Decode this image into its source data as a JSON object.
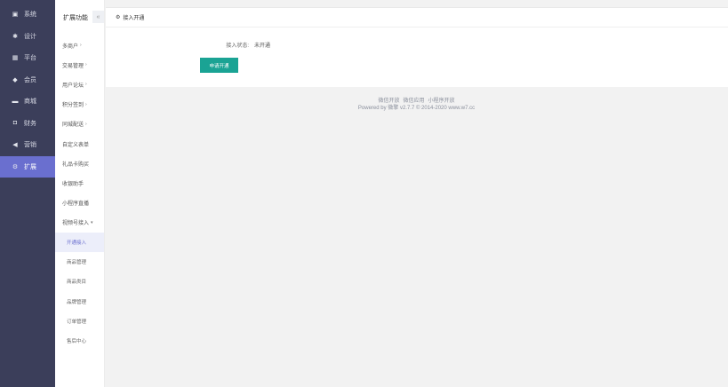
{
  "nav": {
    "items": [
      {
        "icon": "monitor-icon",
        "glyph": "▣",
        "label": "系统",
        "active": false
      },
      {
        "icon": "shirt-icon",
        "glyph": "✱",
        "label": "设计",
        "active": false
      },
      {
        "icon": "grid-icon",
        "glyph": "▦",
        "label": "平台",
        "active": false
      },
      {
        "icon": "member-icon",
        "glyph": "◆",
        "label": "会员",
        "active": false
      },
      {
        "icon": "shop-icon",
        "glyph": "▬",
        "label": "商城",
        "active": false
      },
      {
        "icon": "finance-icon",
        "glyph": "◘",
        "label": "财务",
        "active": false
      },
      {
        "icon": "megaphone-icon",
        "glyph": "◀",
        "label": "营销",
        "active": false
      },
      {
        "icon": "extend-icon",
        "glyph": "⚙",
        "label": "扩展",
        "active": true
      }
    ]
  },
  "subnav": {
    "title": "扩展功能",
    "collapse": "«",
    "items": [
      {
        "label": "多商户",
        "caret": "›"
      },
      {
        "label": "交易管理",
        "caret": "›"
      },
      {
        "label": "用户论坛",
        "caret": "›"
      },
      {
        "label": "积分签到",
        "caret": "›"
      },
      {
        "label": "同城配送",
        "caret": "›"
      },
      {
        "label": "自定义表单",
        "caret": ""
      },
      {
        "label": "礼品卡购买",
        "caret": ""
      },
      {
        "label": "收银助手",
        "caret": ""
      },
      {
        "label": "小程序直播",
        "caret": ""
      },
      {
        "label": "视频号接入",
        "caret": "▾"
      }
    ],
    "children": [
      {
        "label": "开通接入",
        "active": true
      },
      {
        "label": "商品管理",
        "active": false
      },
      {
        "label": "商品类目",
        "active": false
      },
      {
        "label": "品牌管理",
        "active": false
      },
      {
        "label": "订单管理",
        "active": false
      },
      {
        "label": "售后中心",
        "active": false
      }
    ]
  },
  "panel": {
    "title": "接入开通",
    "status_label": "接入状态:",
    "status_value": "未开通",
    "apply_button": "申请开通"
  },
  "footer": {
    "links": [
      "微信开放",
      "微信应用",
      "小程序开放"
    ],
    "powered": "Powered by 微擎 v2.7.7 © 2014-2020 www.w7.cc"
  }
}
